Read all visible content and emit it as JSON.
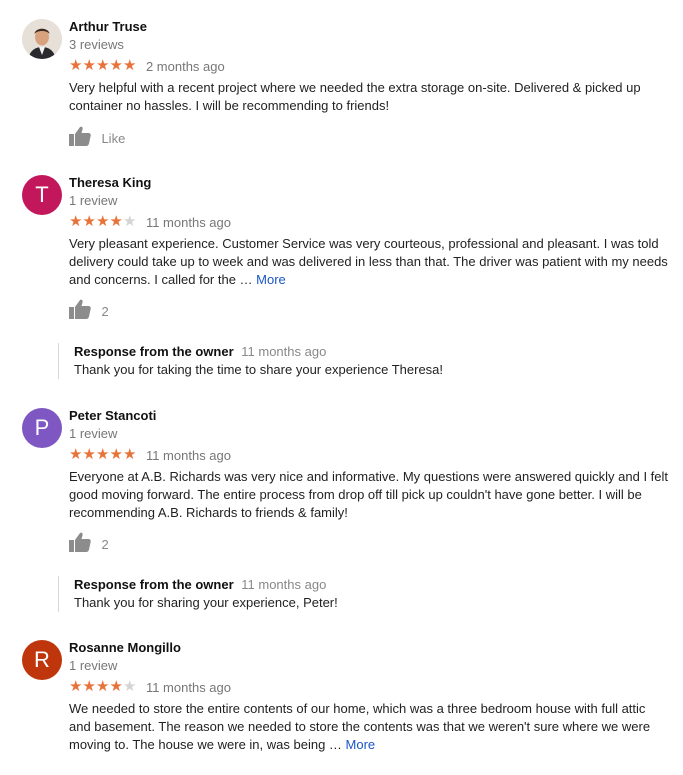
{
  "reviews": [
    {
      "name": "Arthur Truse",
      "review_count": "3 reviews",
      "avatar": {
        "type": "photo",
        "icon": "person-photo-icon"
      },
      "rating": 5,
      "date": "2 months ago",
      "text": "Very helpful with a recent project where we needed the extra storage on-site. Delivered & picked up container no hassles. I will be recommending to friends!",
      "more_label": "",
      "like_label": "Like",
      "response": null
    },
    {
      "name": "Theresa King",
      "review_count": "1 review",
      "avatar": {
        "type": "letter",
        "letter": "T",
        "color": "#c2185b"
      },
      "rating": 4,
      "date": "11 months ago",
      "text": "Very pleasant experience.  Customer Service was very courteous, professional and pleasant.  I was told delivery could take up to week and was delivered in less than that.  The driver was patient with my needs and concerns.  I called for the …",
      "more_label": "More",
      "like_label": "2",
      "response": {
        "title": "Response from the owner",
        "date": "11 months ago",
        "text": "Thank you for taking the time to share your experience Theresa!"
      }
    },
    {
      "name": "Peter Stancoti",
      "review_count": "1 review",
      "avatar": {
        "type": "letter",
        "letter": "P",
        "color": "#7e57c2"
      },
      "rating": 5,
      "date": "11 months ago",
      "text": "Everyone at A.B. Richards was very nice and informative. My questions were answered quickly and  I felt good moving forward. The entire process from drop off till pick up couldn't have gone better. I will be recommending A.B. Richards to friends & family!",
      "more_label": "",
      "like_label": "2",
      "response": {
        "title": "Response from the owner",
        "date": "11 months ago",
        "text": "Thank you for sharing your experience, Peter!"
      }
    },
    {
      "name": "Rosanne Mongillo",
      "review_count": "1 review",
      "avatar": {
        "type": "letter",
        "letter": "R",
        "color": "#bf360c"
      },
      "rating": 4,
      "date": "11 months ago",
      "text": "We needed to store the entire contents of our home, which was a three bedroom house with full attic and basement. The reason we needed to store the contents was that we weren't sure where we were moving to. The house we were in, was being …",
      "more_label": "More",
      "like_label": null,
      "response": null
    }
  ],
  "colors": {
    "star_on": "#e8733a",
    "star_off": "#d4d4d4",
    "link": "#1a56c8"
  }
}
